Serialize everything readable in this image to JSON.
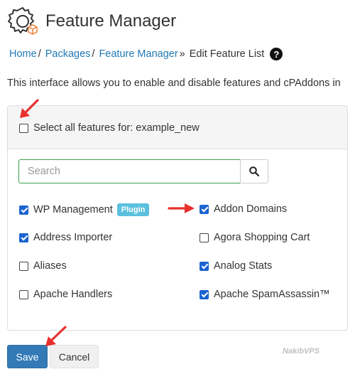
{
  "header": {
    "title": "Feature Manager",
    "icon": "gear-cube-icon"
  },
  "breadcrumb": {
    "items": [
      "Home",
      "Packages",
      "Feature Manager"
    ],
    "separators": [
      "/",
      "/",
      "»"
    ],
    "current": "Edit Feature List",
    "help_icon": "question-circle-icon",
    "help_glyph": "?"
  },
  "intro": "This interface allows you to enable and disable features and cPAddons in",
  "select_all": {
    "label": "Select all features for: example_new",
    "checked": false
  },
  "search": {
    "placeholder": "Search",
    "value": "",
    "icon": "search-icon"
  },
  "features": [
    {
      "label": "WP Management",
      "checked": true,
      "badge": "Plugin"
    },
    {
      "label": "Addon Domains",
      "checked": true
    },
    {
      "label": "Address Importer",
      "checked": true
    },
    {
      "label": "Agora Shopping Cart",
      "checked": false
    },
    {
      "label": "Aliases",
      "checked": false
    },
    {
      "label": "Analog Stats",
      "checked": true
    },
    {
      "label": "Apache Handlers",
      "checked": false
    },
    {
      "label": "Apache SpamAssassin™",
      "checked": true
    }
  ],
  "buttons": {
    "save": "Save",
    "cancel": "Cancel"
  },
  "watermark": "NakibVPS",
  "colors": {
    "link": "#1f78b4",
    "checkbox": "#1c64d0",
    "badge": "#5bc0de",
    "primary": "#337ab7",
    "arrow": "#e8302f",
    "search_border": "#3c9e50"
  }
}
